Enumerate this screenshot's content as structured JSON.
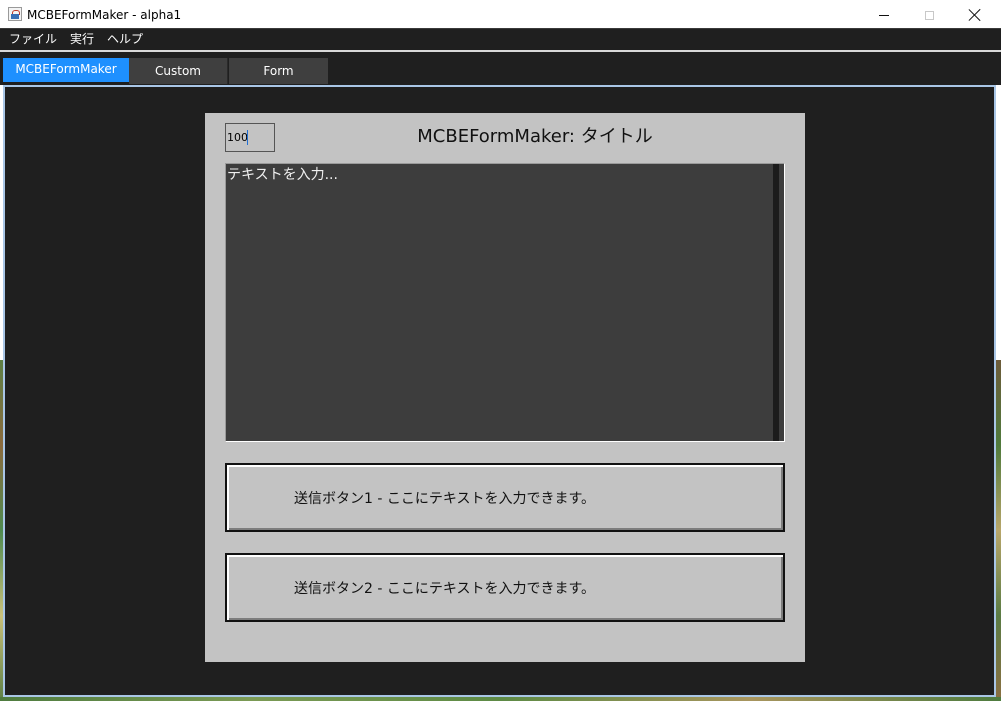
{
  "window": {
    "title": "MCBEFormMaker - alpha1"
  },
  "menu": {
    "items": [
      {
        "label": "ファイル"
      },
      {
        "label": "実行"
      },
      {
        "label": "ヘルプ"
      }
    ]
  },
  "tabs": [
    {
      "label": "MCBEFormMaker",
      "active": true
    },
    {
      "label": "Custom",
      "active": false
    },
    {
      "label": "Form",
      "active": false
    }
  ],
  "form": {
    "number_value": "100",
    "title": "MCBEFormMaker: タイトル",
    "textarea_text": "テキストを入力...",
    "buttons": [
      {
        "label": "送信ボタン1 - ここにテキストを入力できます。"
      },
      {
        "label": "送信ボタン2 - ここにテキストを入力できます。"
      }
    ]
  },
  "colors": {
    "active_tab": "#1e90ff",
    "panel_bg": "#c3c3c3",
    "app_bg": "#1f1f1f",
    "textarea_bg": "#3d3d3d"
  },
  "icons": {
    "app": "java-app-icon",
    "minimize": "minimize-icon",
    "maximize": "maximize-icon",
    "close": "close-icon"
  }
}
